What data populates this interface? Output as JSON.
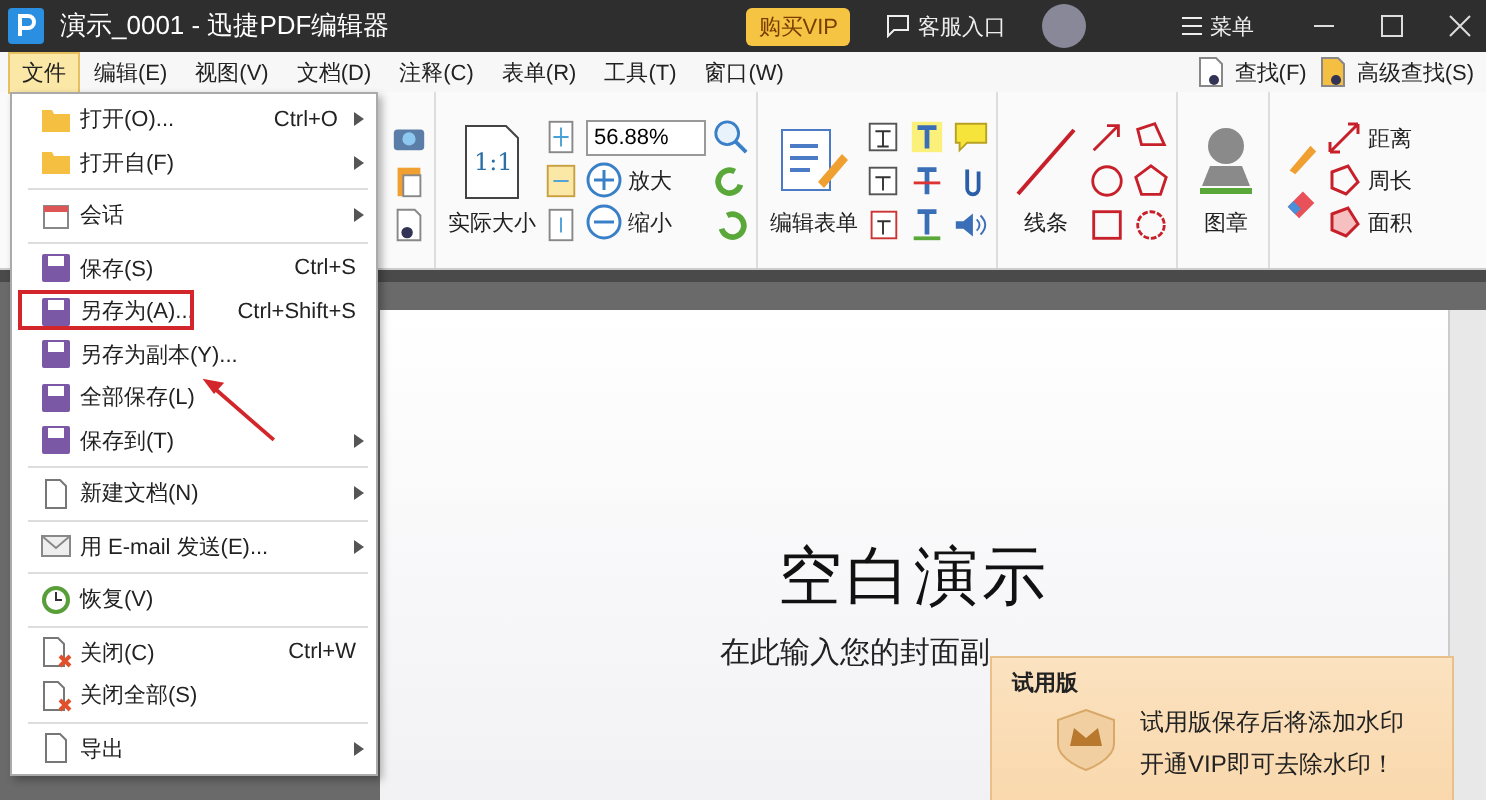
{
  "window": {
    "title": "演示_0001 - 迅捷PDF编辑器",
    "vip_button": "购买VIP",
    "support_link": "客服入口",
    "menu_button": "菜单"
  },
  "menubar": {
    "items": [
      {
        "label": "文件",
        "selected": true
      },
      {
        "label": "编辑(E)",
        "selected": false
      },
      {
        "label": "视图(V)",
        "selected": false
      },
      {
        "label": "文档(D)",
        "selected": false
      },
      {
        "label": "注释(C)",
        "selected": false
      },
      {
        "label": "表单(R)",
        "selected": false
      },
      {
        "label": "工具(T)",
        "selected": false
      },
      {
        "label": "窗口(W)",
        "selected": false
      }
    ],
    "find_buttons": [
      "查找(F)",
      "高级查找(S)"
    ]
  },
  "ribbon": {
    "actual_size_glyph": "1:1",
    "actual_size": "实际大小",
    "zoom_value": "56.88%",
    "zoom_in": "放大",
    "zoom_out": "缩小",
    "edit_form": "编辑表单",
    "line": "线条",
    "stamp": "图章",
    "measure": [
      "距离",
      "周长",
      "面积"
    ]
  },
  "file_menu": {
    "groups": [
      [
        {
          "label": "打开(O)...",
          "shortcut": "Ctrl+O",
          "submenu": true
        },
        {
          "label": "打开自(F)",
          "submenu": true
        }
      ],
      [
        {
          "label": "会话",
          "submenu": true
        }
      ],
      [
        {
          "label": "保存(S)",
          "shortcut": "Ctrl+S",
          "submenu": false
        },
        {
          "label": "另存为(A)...",
          "shortcut": "Ctrl+Shift+S",
          "submenu": false
        },
        {
          "label": "另存为副本(Y)...",
          "submenu": false
        },
        {
          "label": "全部保存(L)",
          "submenu": false
        },
        {
          "label": "保存到(T)",
          "submenu": true
        }
      ],
      [
        {
          "label": "新建文档(N)",
          "submenu": true
        }
      ],
      [
        {
          "label": "用 E-mail 发送(E)...",
          "submenu": true
        }
      ],
      [
        {
          "label": "恢复(V)",
          "submenu": false
        }
      ],
      [
        {
          "label": "关闭(C)",
          "shortcut": "Ctrl+W",
          "submenu": false
        },
        {
          "label": "关闭全部(S)",
          "submenu": false
        }
      ],
      [
        {
          "label": "导出",
          "submenu": true
        }
      ]
    ]
  },
  "document": {
    "title": "空白演示",
    "subtitle": "在此输入您的封面副"
  },
  "trial_popup": {
    "title": "试用版",
    "lines": [
      "试用版保存后将添加水印",
      "开通VIP即可去除水印！"
    ]
  }
}
